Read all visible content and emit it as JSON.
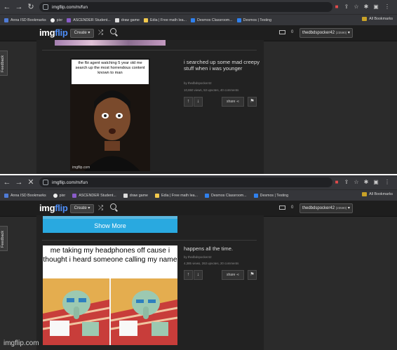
{
  "browser": {
    "url": "imgflip.com/m/fun",
    "bookmarks": [
      "Anna ISD Bookmarks",
      "pixr",
      "ASCENDER Student...",
      "draw game",
      "Edia | Free math lea...",
      "Desmos Classroom...",
      "Desmos | Testing"
    ],
    "bookmarks_short": [
      "Anna ISD Bookmarks",
      "pixr",
      "ASCENDER Student...",
      "draw game",
      "Edia | Free math lea...",
      "Desmos Classroom...",
      "Desmos | Testing"
    ],
    "all_bookmarks": "All Bookmarks"
  },
  "site": {
    "logo_img": "img",
    "logo_flip": "flip",
    "create_label": "Create ▾",
    "notifications": "0",
    "username_top": "thedbdspocker42",
    "points_top": "(23590)",
    "username_bottom": "thedbdspocker42",
    "points_bottom": "(23590)",
    "feedback_label": "Feedback"
  },
  "posts": {
    "first": {
      "caption": "the fbi agent watching 5 year old me search up the most horrendous content known to man",
      "title": "i searched up some mad creepy stuff when i was younger",
      "author": "by thedbdspocker42",
      "stats": "10,650 views, 53 upvotes, 40 comments",
      "share": "share",
      "watermark": "imgflip.com"
    },
    "second": {
      "caption": "me taking my headphones off cause i thought i heard someone calling my name",
      "title": "happens all the time.",
      "author": "by thedbdspocker42",
      "stats": "4,385 views, 263 upvotes, 20 comments",
      "share": "share",
      "watermark": "imgflip.com"
    }
  },
  "show_more": "Show More",
  "colors": {
    "accent": "#29a9e0",
    "logo_blue": "#4e8ef7",
    "chrome": "#35363a"
  }
}
